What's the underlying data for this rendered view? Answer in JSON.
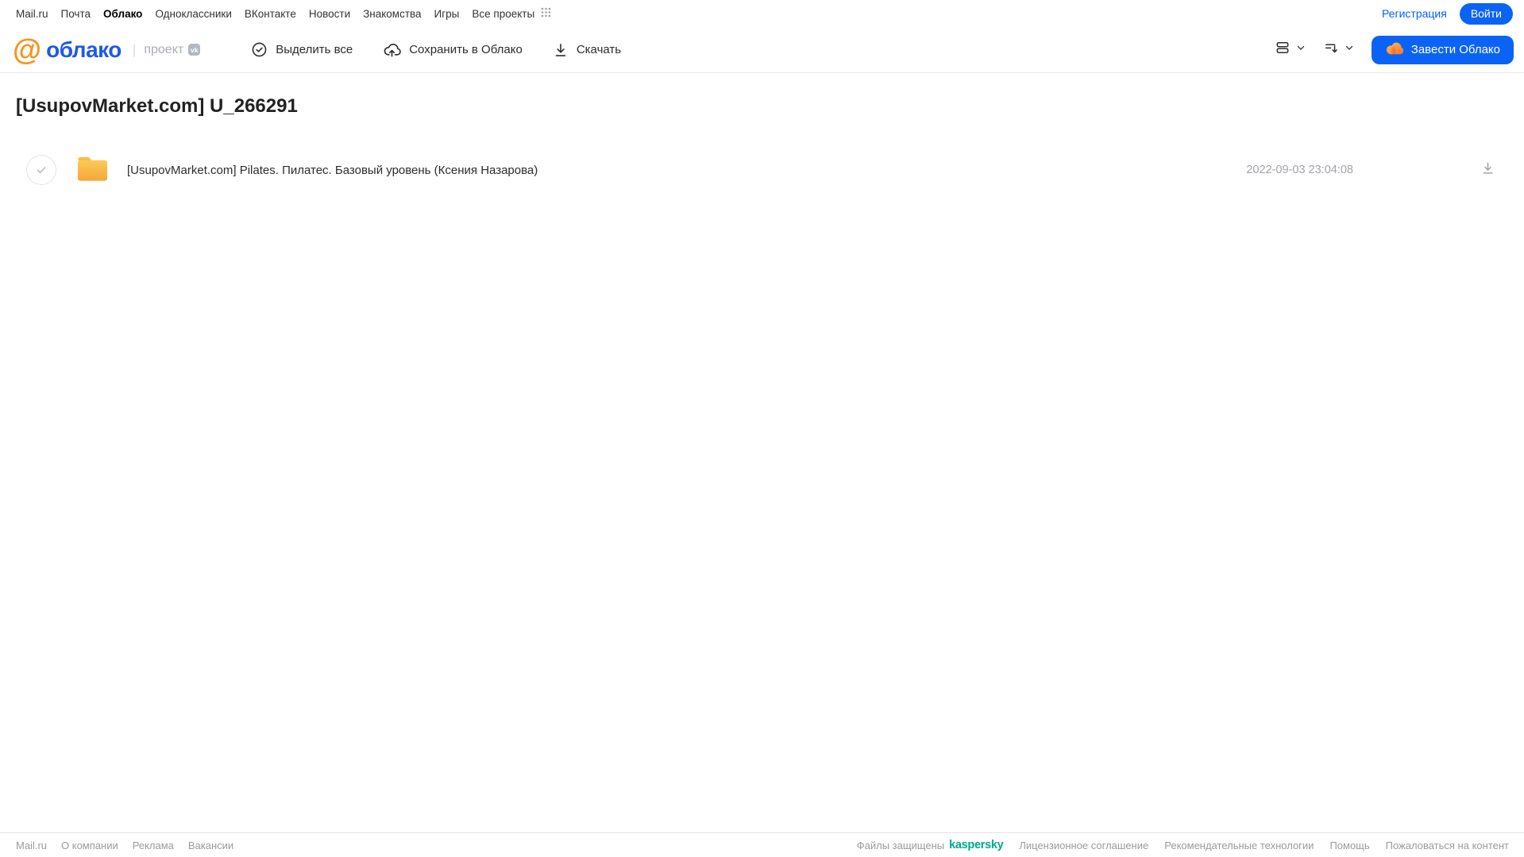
{
  "topbar": {
    "links": [
      {
        "label": "Mail.ru"
      },
      {
        "label": "Почта"
      },
      {
        "label": "Облако",
        "active": true
      },
      {
        "label": "Одноклассники"
      },
      {
        "label": "ВКонтакте"
      },
      {
        "label": "Новости"
      },
      {
        "label": "Знакомства"
      },
      {
        "label": "Игры"
      },
      {
        "label": "Все проекты"
      }
    ],
    "registration_label": "Регистрация",
    "login_label": "Войти"
  },
  "header": {
    "logo_at": "@",
    "logo_text": "облако",
    "project_label": "проект",
    "vk_badge_label": "vk",
    "toolbar": {
      "select_all_label": "Выделить все",
      "save_to_cloud_label": "Сохранить в Облако",
      "download_label": "Скачать"
    },
    "get_cloud_button_label": "Завести Облако"
  },
  "main": {
    "title": "[UsupovMarket.com] U_266291",
    "files": [
      {
        "name": "[UsupovMarket.com] Pilates. Пилатес. Базовый уровень (Ксения Назарова)",
        "date": "2022-09-03 23:04:08"
      }
    ]
  },
  "footer": {
    "left_links": [
      "Mail.ru",
      "О компании",
      "Реклама",
      "Вакансии"
    ],
    "protected_label": "Файлы защищены",
    "kaspersky_label": "kaspersky",
    "right_links": [
      "Лицензионное соглашение",
      "Рекомендательные технологии",
      "Помощь",
      "Пожаловаться на контент"
    ]
  },
  "colors": {
    "accent_blue": "#0b63f6",
    "logo_blue": "#1e5ae8",
    "logo_orange": "#f7941d",
    "folder_yellow": "#f6b73c",
    "kaspersky_teal": "#00a88e",
    "footer_gray": "#9b9b9b"
  }
}
